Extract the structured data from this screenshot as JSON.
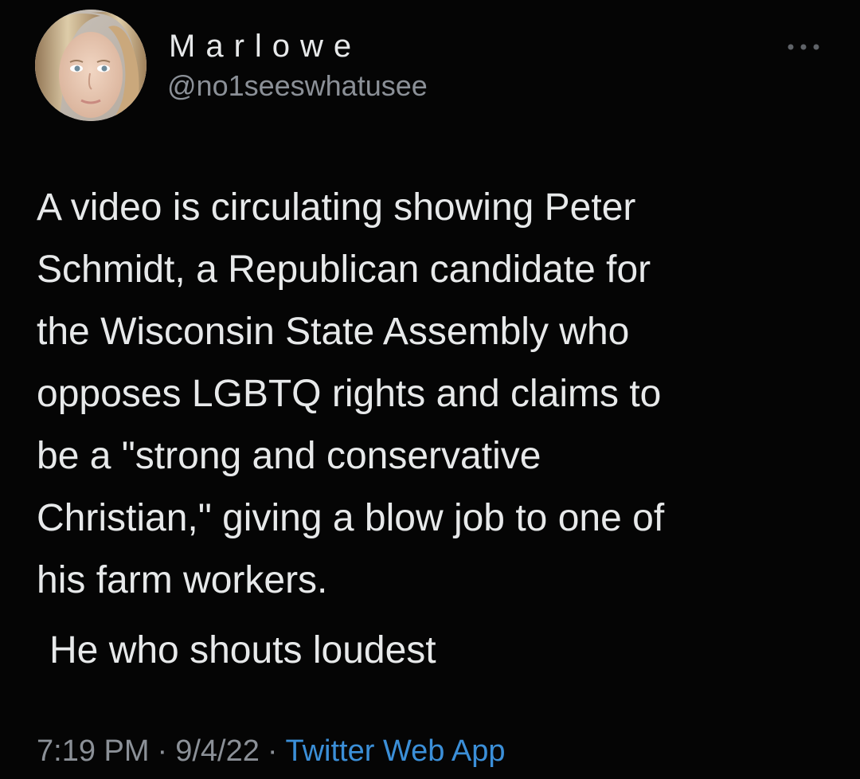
{
  "tweet": {
    "display_name": "Marlowe",
    "handle": "@no1seeswhatusee",
    "text_main": "A video is circulating showing Peter\nSchmidt, a Republican candidate for\nthe Wisconsin State Assembly who\nopposes LGBTQ rights and claims to\nbe a \"strong and conservative\nChristian,\" giving a blow job to one of\nhis farm workers.",
    "text_follow": "He who shouts loudest",
    "time": "7:19 PM",
    "separator": "·",
    "date": "9/4/22",
    "source": "Twitter Web App"
  },
  "icons": {
    "avatar": "profile-photo",
    "more": "more-icon"
  },
  "colors": {
    "background": "#050505",
    "text": "#e7e9ea",
    "secondary_text": "#8b9097",
    "link": "#3b8fd8"
  }
}
